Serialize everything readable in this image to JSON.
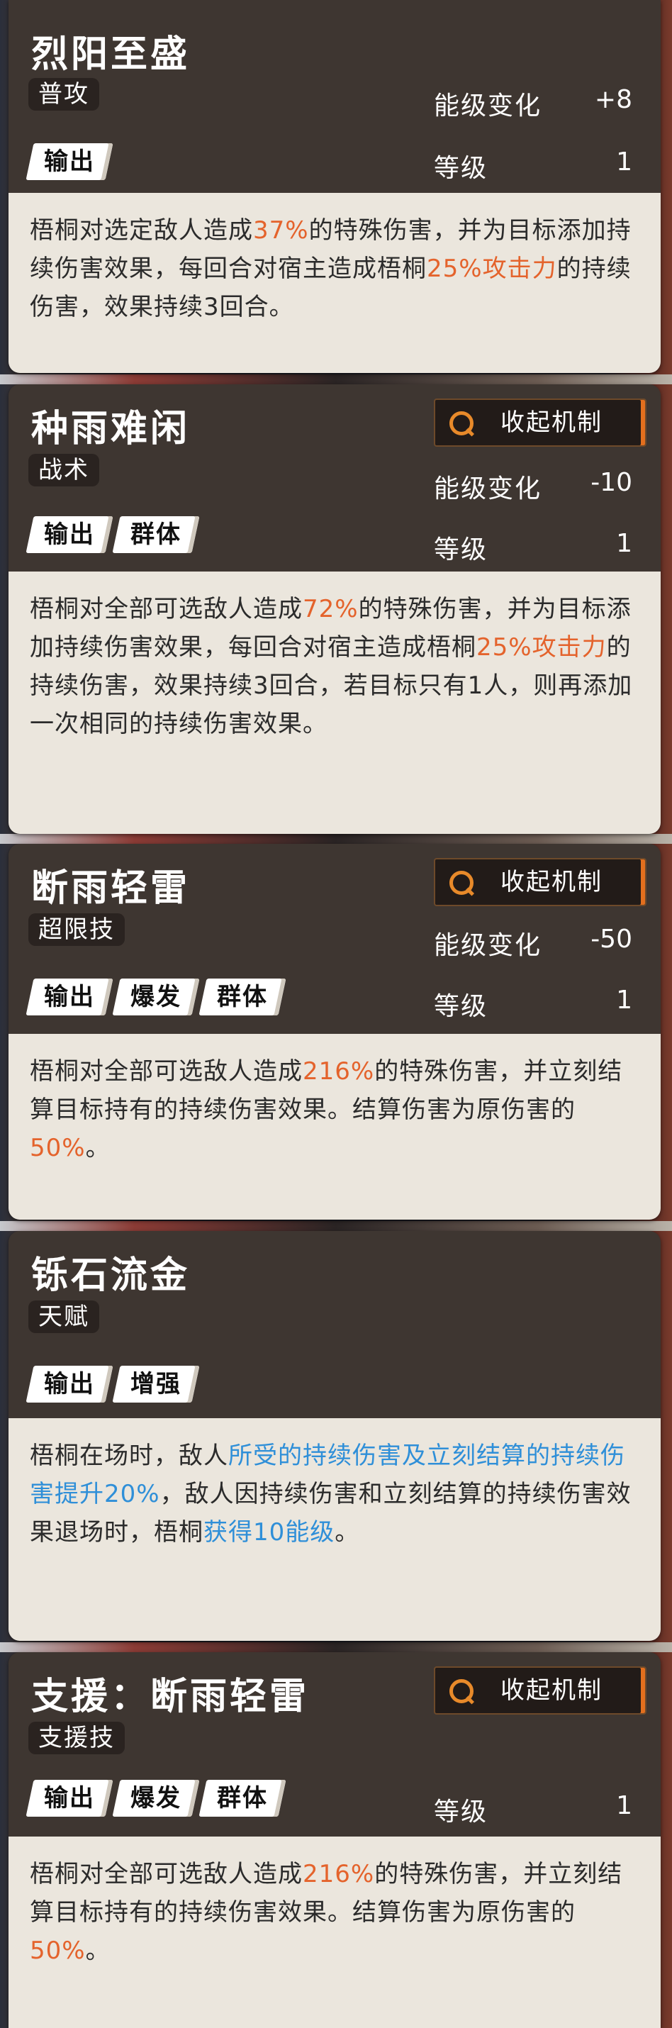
{
  "common": {
    "stat_level_label": "能级变化",
    "stat_grade_label": "等级"
  },
  "cards": [
    {
      "title": "烈阳至盛",
      "type": "普攻",
      "tags": [
        "输出"
      ],
      "energy_change": "+8",
      "grade": "1",
      "mechanism_button": null,
      "description": [
        {
          "text": "梧桐对选定敌人造成"
        },
        {
          "text": "37%",
          "hl": "orange"
        },
        {
          "text": "的特殊伤害，并为目标添加持续伤害效果，每回合对宿主造成梧桐"
        },
        {
          "text": "25%攻击力",
          "hl": "orange"
        },
        {
          "text": "的持续伤害，效果持续3回合。"
        }
      ]
    },
    {
      "title": "种雨难闲",
      "type": "战术",
      "tags": [
        "输出",
        "群体"
      ],
      "energy_change": "-10",
      "grade": "1",
      "mechanism_button": "收起机制",
      "description": [
        {
          "text": "梧桐对全部可选敌人造成"
        },
        {
          "text": "72%",
          "hl": "orange"
        },
        {
          "text": "的特殊伤害，并为目标添加持续伤害效果，每回合对宿主造成梧桐"
        },
        {
          "text": "25%攻击力",
          "hl": "orange"
        },
        {
          "text": "的持续伤害，效果持续3回合，若目标只有1人，则再添加一次相同的持续伤害效果。"
        }
      ]
    },
    {
      "title": "断雨轻雷",
      "type": "超限技",
      "tags": [
        "输出",
        "爆发",
        "群体"
      ],
      "energy_change": "-50",
      "grade": "1",
      "mechanism_button": "收起机制",
      "description": [
        {
          "text": "梧桐对全部可选敌人造成"
        },
        {
          "text": "216%",
          "hl": "orange"
        },
        {
          "text": "的特殊伤害，并立刻结算目标持有的持续伤害效果。结算伤害为原伤害的"
        },
        {
          "text": "50%",
          "hl": "orange"
        },
        {
          "text": "。"
        }
      ]
    },
    {
      "title": "铄石流金",
      "type": "天赋",
      "tags": [
        "输出",
        "增强"
      ],
      "energy_change": null,
      "grade": null,
      "mechanism_button": null,
      "description": [
        {
          "text": "梧桐在场时，敌人"
        },
        {
          "text": "所受的持续伤害及立刻结算的持续伤害提升20%",
          "hl": "blue"
        },
        {
          "text": "，敌人因持续伤害和立刻结算的持续伤害效果退场时，梧桐"
        },
        {
          "text": "获得10能级",
          "hl": "blue"
        },
        {
          "text": "。"
        }
      ]
    },
    {
      "title": "支援：断雨轻雷",
      "type": "支援技",
      "tags": [
        "输出",
        "爆发",
        "群体"
      ],
      "energy_change": null,
      "grade": "1",
      "mechanism_button": "收起机制",
      "description": [
        {
          "text": "梧桐对全部可选敌人造成"
        },
        {
          "text": "216%",
          "hl": "orange"
        },
        {
          "text": "的特殊伤害，并立刻结算目标持有的持续伤害效果。结算伤害为原伤害的"
        },
        {
          "text": "50%",
          "hl": "orange"
        },
        {
          "text": "。"
        }
      ]
    }
  ]
}
